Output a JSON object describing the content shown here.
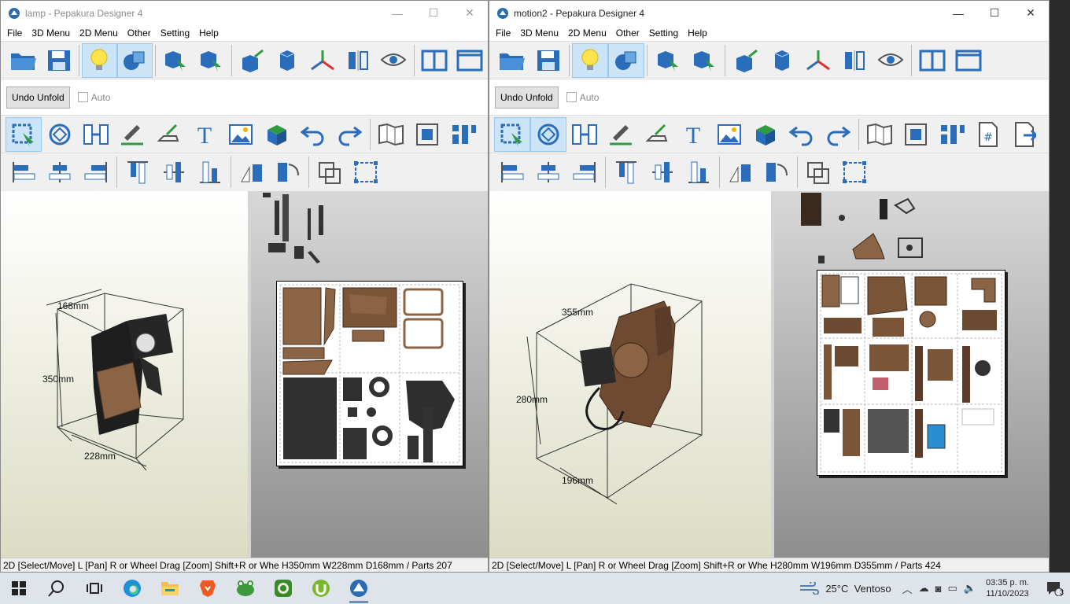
{
  "windows": [
    {
      "id": "left",
      "title": "lamp - Pepakura Designer 4",
      "menu": [
        "File",
        "3D Menu",
        "2D Menu",
        "Other",
        "Setting",
        "Help"
      ],
      "undo_label": "Undo Unfold",
      "auto_label": "Auto",
      "dims": {
        "a": "168mm",
        "b": "350mm",
        "c": "228mm"
      },
      "status": "2D [Select/Move] L [Pan] R or Wheel Drag [Zoom] Shift+R or Whe H350mm W228mm D168mm / Parts 207"
    },
    {
      "id": "right",
      "title": "motion2 - Pepakura Designer 4",
      "menu": [
        "File",
        "3D Menu",
        "2D Menu",
        "Other",
        "Setting",
        "Help"
      ],
      "undo_label": "Undo Unfold",
      "auto_label": "Auto",
      "dims": {
        "a": "355mm",
        "b": "280mm",
        "c": "196mm"
      },
      "status": "2D [Select/Move] L [Pan] R or Wheel Drag [Zoom] Shift+R or Whe H280mm W196mm D355mm / Parts 424"
    }
  ],
  "window_controls": {
    "minimize": "—",
    "maximize": "☐",
    "close": "✕"
  },
  "taskbar": {
    "apps": [
      "start-icon",
      "search-icon",
      "task-view-icon",
      "edge-icon",
      "file-explorer-icon",
      "brave-icon",
      "frog-app-icon",
      "green-app-icon",
      "utorrent-icon",
      "pepakura-icon"
    ],
    "weather": "25°C  Ventoso",
    "time": "03:35 p. m.",
    "date": "11/10/2023",
    "notifications": "3"
  },
  "colors": {
    "accent": "#1f6fb8",
    "brown": "#8b6345",
    "selected": "#cce4f7"
  }
}
